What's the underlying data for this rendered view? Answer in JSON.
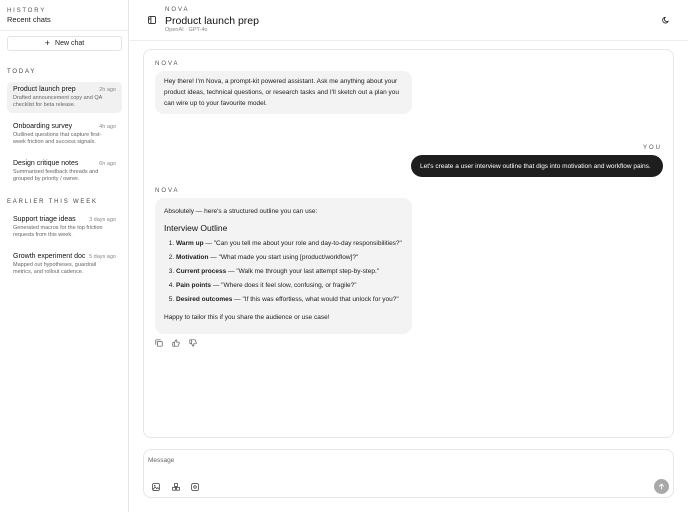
{
  "sidebar": {
    "kicker": "HISTORY",
    "title": "Recent chats",
    "new_chat_label": "New chat",
    "sections": [
      {
        "label": "TODAY",
        "items": [
          {
            "title": "Product launch prep",
            "time": "2h ago",
            "desc": "Drafted announcement copy and QA checklist for beta release."
          },
          {
            "title": "Onboarding survey",
            "time": "4h ago",
            "desc": "Outlined questions that capture first-week friction and success signals."
          },
          {
            "title": "Design critique notes",
            "time": "6h ago",
            "desc": "Summarised feedback threads and grouped by priority / owner."
          }
        ]
      },
      {
        "label": "EARLIER THIS WEEK",
        "items": [
          {
            "title": "Support triage ideas",
            "time": "3 days ago",
            "desc": "Generated macros for the top friction requests from this week."
          },
          {
            "title": "Growth experiment doc",
            "time": "5 days ago",
            "desc": "Mapped out hypotheses, guardrail metrics, and rollout cadence."
          }
        ]
      }
    ]
  },
  "header": {
    "kicker": "NOVA",
    "title": "Product launch prep",
    "subtitle": "OpenAI · GPT-4o"
  },
  "messages": {
    "ai_label": "NOVA",
    "user_label": "YOU",
    "greeting": "Hey there! I'm Nova, a prompt-kit powered assistant. Ask me anything about your product ideas, technical questions, or research tasks and I'll sketch out a plan you can wire up to your favourite model.",
    "user_text": "Let's create a user interview outline that digs into motivation and workflow pains.",
    "reply_intro": "Absolutely — here's a structured outline you can use:",
    "reply_heading": "Interview Outline",
    "outline": [
      {
        "term": "Warm up",
        "text": " — \"Can you tell me about your role and day-to-day responsibilities?\""
      },
      {
        "term": "Motivation",
        "text": " — \"What made you start using [product/workflow]?\""
      },
      {
        "term": "Current process",
        "text": " — \"Walk me through your last attempt step-by-step.\""
      },
      {
        "term": "Pain points",
        "text": " — \"Where does it feel slow, confusing, or fragile?\""
      },
      {
        "term": "Desired outcomes",
        "text": " — \"If this was effortless, what would that unlock for you?\""
      }
    ],
    "reply_outro": "Happy to tailor this if you share the audience or use case!"
  },
  "composer": {
    "placeholder": "Message"
  },
  "icons": {
    "sidebar_toggle": "sidebar-toggle-icon",
    "theme": "moon-icon",
    "copy": "copy-icon",
    "thumbs_up": "thumbs-up-icon",
    "thumbs_down": "thumbs-down-icon",
    "image": "image-icon",
    "shapes": "shapes-icon",
    "settings": "settings-icon",
    "send": "arrow-up-icon"
  },
  "colors": {
    "user_bubble": "#1e1e1e",
    "ai_bubble": "#f3f3f3",
    "active_item": "#f1f1f1",
    "send_button": "#a9a9a9"
  }
}
